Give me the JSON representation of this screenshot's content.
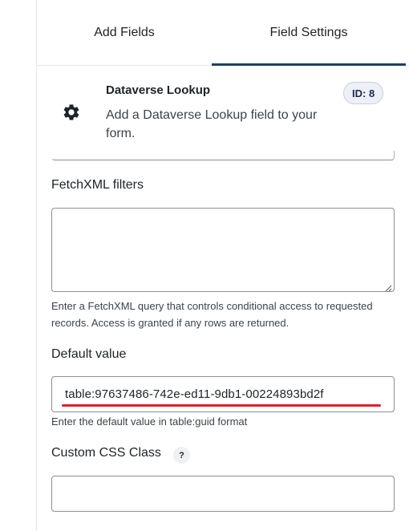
{
  "tabs": {
    "add_fields": "Add Fields",
    "field_settings": "Field Settings"
  },
  "field": {
    "title": "Dataverse Lookup",
    "description": "Add a Dataverse Lookup field to your form.",
    "id_badge": "ID: 8",
    "icon": "gear-icon"
  },
  "fetchxml": {
    "label": "FetchXML filters",
    "value": "",
    "hint": "Enter a FetchXML query that controls conditional access to requested records. Access is granted if any rows are returned."
  },
  "default_value": {
    "label": "Default value",
    "value": "table:97637486-742e-ed11-9db1-00224893bd2f",
    "hint": "Enter the default value in table:guid format"
  },
  "custom_css": {
    "label": "Custom CSS Class",
    "help": "?",
    "value": ""
  },
  "colors": {
    "active_tab": "#1f3f66",
    "annotation": "#e0202a"
  }
}
